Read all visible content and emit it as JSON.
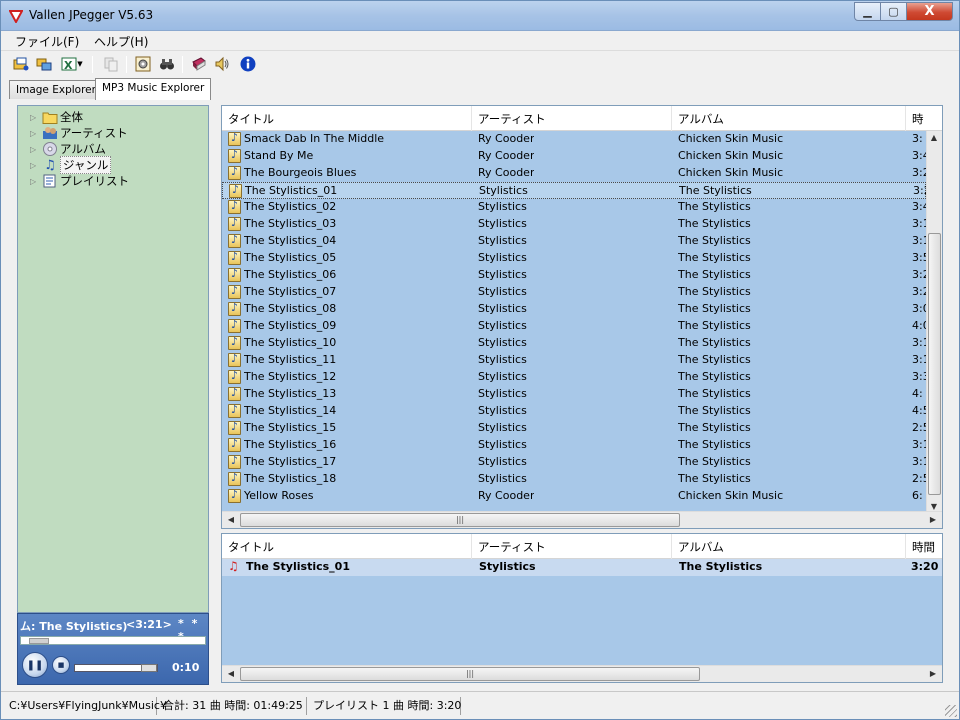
{
  "window": {
    "title": "Vallen JPegger V5.63",
    "close_label": "X"
  },
  "menu": {
    "file": "ファイル(F)",
    "help": "ヘルプ(H)"
  },
  "tabs": [
    {
      "label": "Image Explorer"
    },
    {
      "label": "MP3 Music Explorer"
    }
  ],
  "tree": {
    "items": [
      {
        "label": "全体"
      },
      {
        "label": "アーティスト"
      },
      {
        "label": "アルバム"
      },
      {
        "label": "ジャンル"
      },
      {
        "label": "プレイリスト"
      }
    ]
  },
  "player": {
    "now_playing": "ム: The Stylistics)",
    "duration": "<3:21>",
    "rating": "* * *",
    "elapsed": "0:10"
  },
  "track_list": {
    "columns": [
      "タイトル",
      "アーティスト",
      "アルバム",
      "時"
    ],
    "rows": [
      {
        "title": "Smack Dab In The Middle",
        "artist": "Ry Cooder",
        "album": "Chicken Skin Music",
        "time": "3:"
      },
      {
        "title": "Stand By Me",
        "artist": "Ry Cooder",
        "album": "Chicken Skin Music",
        "time": "3:4"
      },
      {
        "title": "The Bourgeois Blues",
        "artist": "Ry Cooder",
        "album": "Chicken Skin Music",
        "time": "3:2"
      },
      {
        "title": "The Stylistics_01",
        "artist": "Stylistics",
        "album": "The Stylistics",
        "time": "3:2"
      },
      {
        "title": "The Stylistics_02",
        "artist": "Stylistics",
        "album": "The Stylistics",
        "time": "3:4"
      },
      {
        "title": "The Stylistics_03",
        "artist": "Stylistics",
        "album": "The Stylistics",
        "time": "3:1"
      },
      {
        "title": "The Stylistics_04",
        "artist": "Stylistics",
        "album": "The Stylistics",
        "time": "3:1"
      },
      {
        "title": "The Stylistics_05",
        "artist": "Stylistics",
        "album": "The Stylistics",
        "time": "3:5"
      },
      {
        "title": "The Stylistics_06",
        "artist": "Stylistics",
        "album": "The Stylistics",
        "time": "3:2"
      },
      {
        "title": "The Stylistics_07",
        "artist": "Stylistics",
        "album": "The Stylistics",
        "time": "3:2"
      },
      {
        "title": "The Stylistics_08",
        "artist": "Stylistics",
        "album": "The Stylistics",
        "time": "3:0"
      },
      {
        "title": "The Stylistics_09",
        "artist": "Stylistics",
        "album": "The Stylistics",
        "time": "4:0"
      },
      {
        "title": "The Stylistics_10",
        "artist": "Stylistics",
        "album": "The Stylistics",
        "time": "3:1"
      },
      {
        "title": "The Stylistics_11",
        "artist": "Stylistics",
        "album": "The Stylistics",
        "time": "3:1"
      },
      {
        "title": "The Stylistics_12",
        "artist": "Stylistics",
        "album": "The Stylistics",
        "time": "3:3"
      },
      {
        "title": "The Stylistics_13",
        "artist": "Stylistics",
        "album": "The Stylistics",
        "time": "4:"
      },
      {
        "title": "The Stylistics_14",
        "artist": "Stylistics",
        "album": "The Stylistics",
        "time": "4:5"
      },
      {
        "title": "The Stylistics_15",
        "artist": "Stylistics",
        "album": "The Stylistics",
        "time": "2:5"
      },
      {
        "title": "The Stylistics_16",
        "artist": "Stylistics",
        "album": "The Stylistics",
        "time": "3:1"
      },
      {
        "title": "The Stylistics_17",
        "artist": "Stylistics",
        "album": "The Stylistics",
        "time": "3:1"
      },
      {
        "title": "The Stylistics_18",
        "artist": "Stylistics",
        "album": "The Stylistics",
        "time": "2:5"
      },
      {
        "title": "Yellow Roses",
        "artist": "Ry Cooder",
        "album": "Chicken Skin Music",
        "time": "6:"
      }
    ]
  },
  "playlist": {
    "columns": [
      "タイトル",
      "アーティスト",
      "アルバム",
      "時間"
    ],
    "rows": [
      {
        "title": "The Stylistics_01",
        "artist": "Stylistics",
        "album": "The Stylistics",
        "time": "3:20"
      }
    ]
  },
  "status": {
    "path": "C:¥Users¥FlyingJunk¥Music¥",
    "total": "合計: 31 曲 時間: 01:49:25",
    "playlist_info": "プレイリスト 1 曲 時間: 3:20"
  },
  "colors": {
    "tree_bg": "#c0dcc0",
    "list_bg": "#a8c8e8",
    "player_bg": "#4a74b8"
  }
}
